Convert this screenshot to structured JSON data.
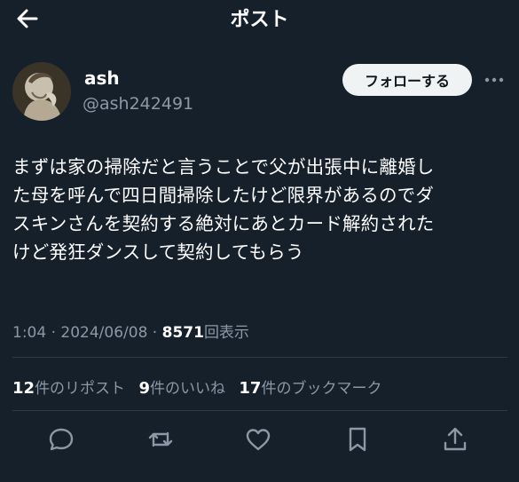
{
  "header": {
    "title": "ポスト",
    "back_icon": "arrow-left-icon"
  },
  "author": {
    "display_name": "ash",
    "handle": "@ash242491",
    "follow_label": "フォローする",
    "more_icon": "more-horizontal-icon"
  },
  "tweet": {
    "lines": [
      "まずは家の掃除だと言うことで父が出張中に離婚し",
      "た母を呼んで四日間掃除したけど限界があるのでダ",
      "スキンさんを契約する絶対にあとカード解約された",
      "けど発狂ダンスして契約してもらう"
    ]
  },
  "meta": {
    "time": "1:04",
    "sep1": " · ",
    "date": "2024/06/08",
    "sep2": " · ",
    "views": "8571",
    "views_label": "回表示"
  },
  "stats": {
    "reposts": {
      "count": "12",
      "label": "件のリポスト"
    },
    "likes": {
      "count": "9",
      "label": "件のいいね"
    },
    "bookmarks": {
      "count": "17",
      "label": "件のブックマーク"
    }
  },
  "actions": [
    "reply-icon",
    "repost-icon",
    "like-icon",
    "bookmark-icon",
    "share-icon"
  ],
  "colors": {
    "background": "#16202b",
    "text": "#ffffff",
    "secondary": "#8b98a5",
    "follow_bg": "#eff3f4"
  }
}
